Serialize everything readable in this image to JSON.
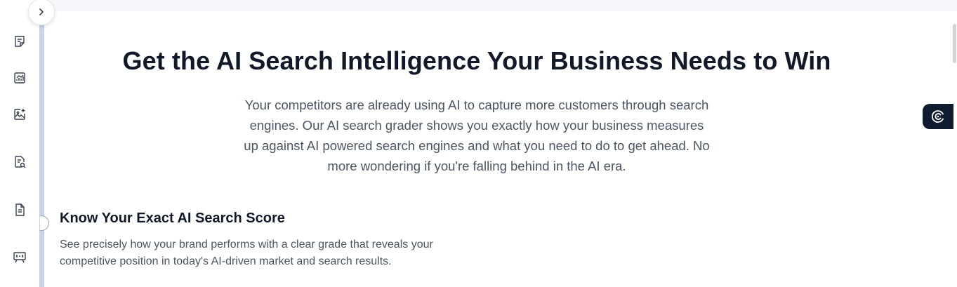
{
  "sidebar": {
    "collapse_icon": "chevron-right-icon",
    "items": [
      {
        "icon": "document-note-icon"
      },
      {
        "icon": "chart-report-icon"
      },
      {
        "icon": "image-sparkle-icon"
      },
      {
        "icon": "document-search-icon"
      },
      {
        "icon": "document-text-icon"
      },
      {
        "icon": "presentation-board-icon"
      }
    ]
  },
  "main": {
    "headline": "Get the AI Search Intelligence Your Business Needs to Win",
    "intro": "Your competitors are already using AI to capture more customers through search engines. Our AI search grader shows you exactly how your business measures up against AI powered search engines and what you need to do to get ahead. No more wondering if you're falling behind in the AI era.",
    "features": [
      {
        "title": "Know Your Exact AI Search Score",
        "description": "See precisely how your brand performs with a clear grade that reveals your competitive position in today's AI-driven market and search results."
      }
    ]
  },
  "widgets": {
    "assistant_icon": "assistant-logo-icon"
  },
  "colors": {
    "headline": "#111827",
    "body_text": "#4b5563",
    "rail_stripe": "#c9d3e6",
    "fab_background": "#0f1b2e"
  }
}
